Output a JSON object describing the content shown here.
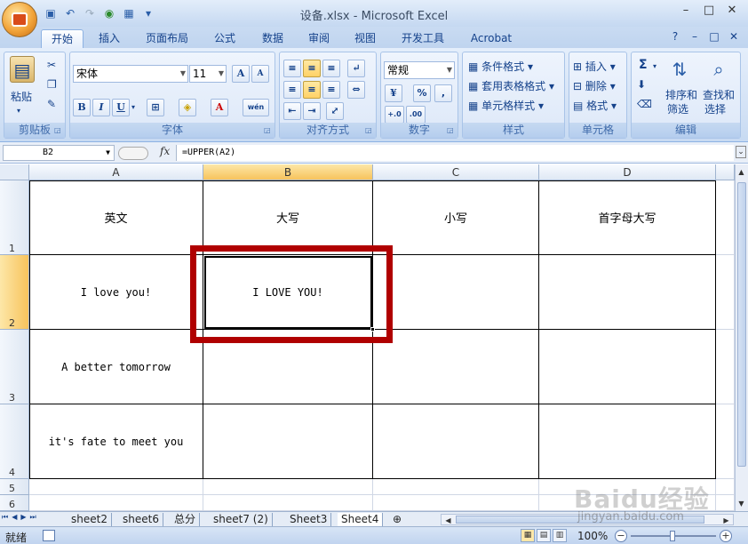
{
  "window": {
    "title": "设备.xlsx - Microsoft Excel"
  },
  "ribbon_tabs": [
    "开始",
    "插入",
    "页面布局",
    "公式",
    "数据",
    "审阅",
    "视图",
    "开发工具",
    "Acrobat"
  ],
  "clipboard": {
    "paste": "粘贴",
    "group": "剪贴板"
  },
  "font": {
    "name": "宋体",
    "size": "11",
    "group": "字体",
    "bold": "B",
    "italic": "I",
    "underline": "U",
    "grow": "A",
    "shrink": "A",
    "color_letter": "A",
    "phonetic": "wén"
  },
  "alignment": {
    "group": "对齐方式"
  },
  "number": {
    "format": "常规",
    "group": "数字",
    "percent": "%",
    "comma": ",",
    "inc": "+.0",
    "dec": ".00"
  },
  "styles": {
    "conditional": "条件格式",
    "table": "套用表格格式",
    "cell": "单元格样式",
    "group": "样式"
  },
  "cells": {
    "insert": "插入",
    "delete": "删除",
    "format": "格式",
    "group": "单元格"
  },
  "editing": {
    "sort1": "排序和",
    "sort2": "筛选",
    "find1": "查找和",
    "find2": "选择",
    "group": "编辑",
    "sum": "Σ"
  },
  "formula_bar": {
    "name_box": "B2",
    "fx": "fx",
    "formula": "=UPPER(A2)"
  },
  "columns": [
    "A",
    "B",
    "C",
    "D"
  ],
  "rows": [
    "1",
    "2",
    "3",
    "4",
    "5",
    "6"
  ],
  "grid": {
    "header": [
      "英文",
      "大写",
      "小写",
      "首字母大写"
    ],
    "r2": [
      "I love you!",
      "I LOVE YOU!",
      "",
      ""
    ],
    "r3": [
      "A better tomorrow",
      "",
      "",
      ""
    ],
    "r4": [
      "it's fate to meet you",
      "",
      "",
      ""
    ]
  },
  "sheets": [
    "sheet2",
    "sheet6",
    "总分",
    "sheet7 (2)",
    "Sheet3",
    "Sheet4"
  ],
  "status": {
    "ready": "就绪",
    "zoom": "100%"
  },
  "watermark": {
    "brand": "Baidu经验",
    "url": "jingyan.baidu.com"
  }
}
